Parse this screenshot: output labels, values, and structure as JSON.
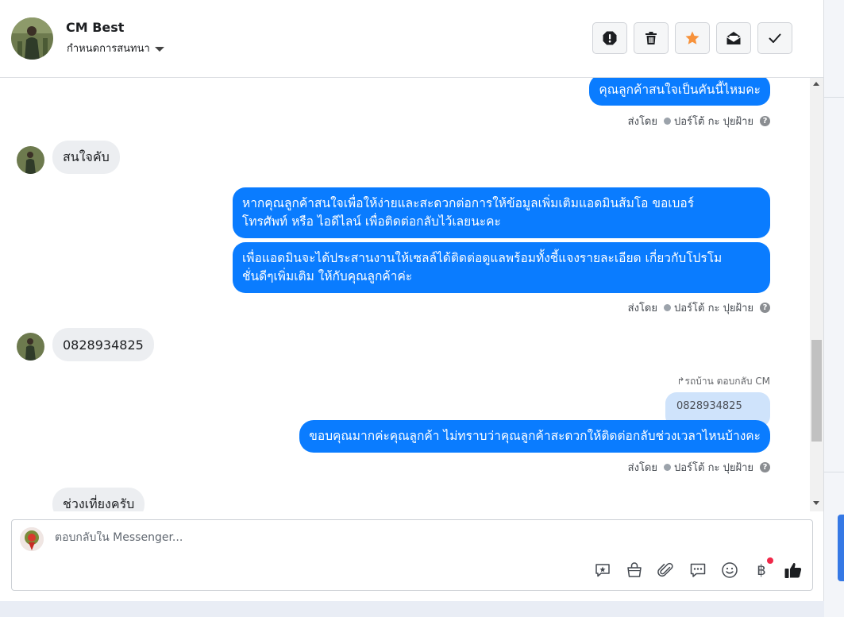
{
  "header": {
    "contact_name": "CM Best",
    "assign_label": "กำหนดการสนทนา",
    "actions": [
      {
        "name": "mark-spam-button",
        "icon": "alert-icon"
      },
      {
        "name": "delete-button",
        "icon": "trash-icon"
      },
      {
        "name": "star-button",
        "icon": "star-icon"
      },
      {
        "name": "mark-unread-button",
        "icon": "envelope-open-icon"
      },
      {
        "name": "mark-done-button",
        "icon": "check-icon"
      }
    ],
    "star_color": "#f7923b"
  },
  "conversation": {
    "messages": [
      {
        "direction": "out",
        "text": "คุณลูกค้าสนใจเป็นคันนี้ไหมคะ"
      },
      {
        "direction": "meta",
        "prefix": "ส่งโดย",
        "agent": "ปอร์โต้ กะ ปุยฝ้าย"
      },
      {
        "direction": "in",
        "text": "สนใจคับ"
      },
      {
        "direction": "out",
        "line1": "หากคุณลูกค้าสนใจเพื่อให้ง่ายและสะดวกต่อการให้ข้อมูลเพิ่มเติมแอดมินส้มโอ ขอเบอร์",
        "line2": "โทรศัพท์ หรือ ไอดีไลน์ เพื่อติดต่อกลับไว้เลยนะคะ"
      },
      {
        "direction": "out",
        "line1": "เพื่อแอดมินจะได้ประสานงานให้เซลล์ได้ติดต่อดูแลพร้อมทั้งชี้แจงรายละเอียด เกี่ยวกับโปรโม",
        "line2": "ชั่นดีๆเพิ่มเติม ให้กับคุณลูกค้าค่ะ"
      },
      {
        "direction": "meta",
        "prefix": "ส่งโดย",
        "agent": "ปอร์โต้ กะ ปุยฝ้าย"
      },
      {
        "direction": "in",
        "text": "0828934825"
      },
      {
        "direction": "reply-note",
        "text": "รถบ้าน ตอบกลับ CM"
      },
      {
        "direction": "quoted",
        "text": "0828934825"
      },
      {
        "direction": "out",
        "text": "ขอบคุณมากค่ะคุณลูกค้า ไม่ทราบว่าคุณลูกค้าสะดวกให้ติดต่อกลับช่วงเวลาไหนบ้างคะ"
      },
      {
        "direction": "meta",
        "prefix": "ส่งโดย",
        "agent": "ปอร์โต้ กะ ปุยฝ้าย"
      },
      {
        "direction": "in",
        "text": "ช่วงเที่ยงครับ"
      }
    ],
    "help_glyph": "?"
  },
  "composer": {
    "placeholder": "ตอบกลับใน Messenger...",
    "baht_glyph": "฿",
    "tools": [
      "saved-reply-icon",
      "shop-icon",
      "attachment-icon",
      "quick-reply-icon",
      "emoji-icon",
      "payment-icon",
      "like-icon"
    ]
  },
  "colors": {
    "outgoing_bubble": "#0a7cff",
    "incoming_bubble": "#eceef1",
    "quoted_bubble": "#cfe3fb",
    "notification_dot": "#f02849"
  }
}
